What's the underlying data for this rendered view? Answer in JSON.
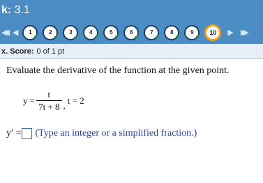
{
  "header": {
    "label": "k:",
    "number": "3.1"
  },
  "nav": {
    "first_glyph": "◀◀",
    "prev_glyph": "◀",
    "next_glyph": "▶",
    "last_glyph": "▶▶",
    "check_glyph": "✔",
    "questions": [
      "1",
      "2",
      "3",
      "4",
      "5",
      "6",
      "7",
      "8",
      "9",
      "10"
    ],
    "current": "10"
  },
  "score": {
    "label": "x. Score:",
    "value": "0 of 1 pt"
  },
  "problem": {
    "instruction": "Evaluate the derivative of the function at the given point.",
    "y_lhs": "y =",
    "numerator": "t",
    "denominator": "7t + 8",
    "separator": ",",
    "point": "t = 2"
  },
  "answer": {
    "label": "y′ =",
    "value": "",
    "hint": "(Type an integer or a simplified fraction.)"
  },
  "colors": {
    "bar": "#4c8cc5",
    "current_ring": "#f0a21a",
    "check": "#2f8f1e"
  }
}
